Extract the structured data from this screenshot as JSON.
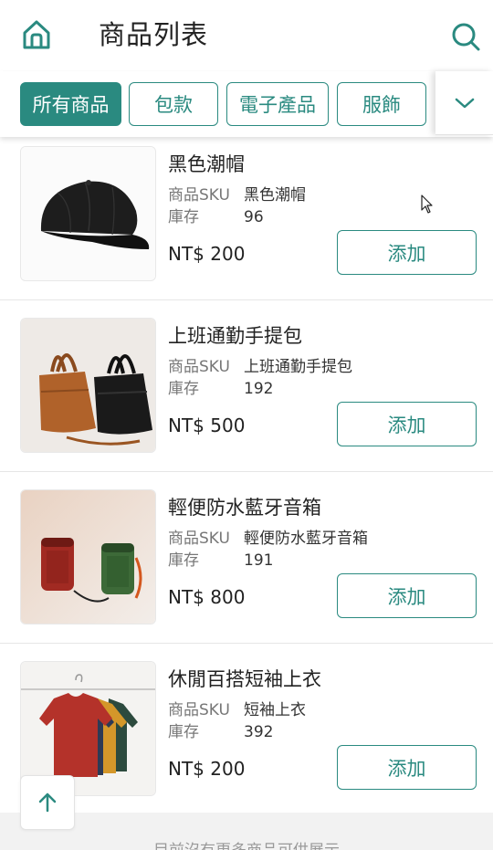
{
  "header": {
    "title": "商品列表",
    "home_icon": "home-icon",
    "search_icon": "search-icon"
  },
  "categories": {
    "tabs": [
      {
        "label": "所有商品",
        "active": true
      },
      {
        "label": "包款",
        "active": false
      },
      {
        "label": "電子產品",
        "active": false
      },
      {
        "label": "服飾",
        "active": false
      }
    ],
    "expand_icon": "chevron-down-icon"
  },
  "labels": {
    "sku": "商品SKU",
    "stock": "庫存",
    "add": "添加"
  },
  "products": [
    {
      "name": "黑色潮帽",
      "sku": "黑色潮帽",
      "stock": "96",
      "price": "NT$ 200",
      "image": "black-cap"
    },
    {
      "name": "上班通勤手提包",
      "sku": "上班通勤手提包",
      "stock": "192",
      "price": "NT$ 500",
      "image": "handbags"
    },
    {
      "name": "輕便防水藍牙音箱",
      "sku": "輕便防水藍牙音箱",
      "stock": "191",
      "price": "NT$ 800",
      "image": "bluetooth-speakers"
    },
    {
      "name": "休閒百搭短袖上衣",
      "sku": "短袖上衣",
      "stock": "392",
      "price": "NT$ 200",
      "image": "tshirts"
    }
  ],
  "footer": {
    "note": "目前沒有更多商品可供展示"
  },
  "colors": {
    "accent": "#2a8a80",
    "divider": "#e6e6e6",
    "footer_bg": "#f2f2f2"
  }
}
